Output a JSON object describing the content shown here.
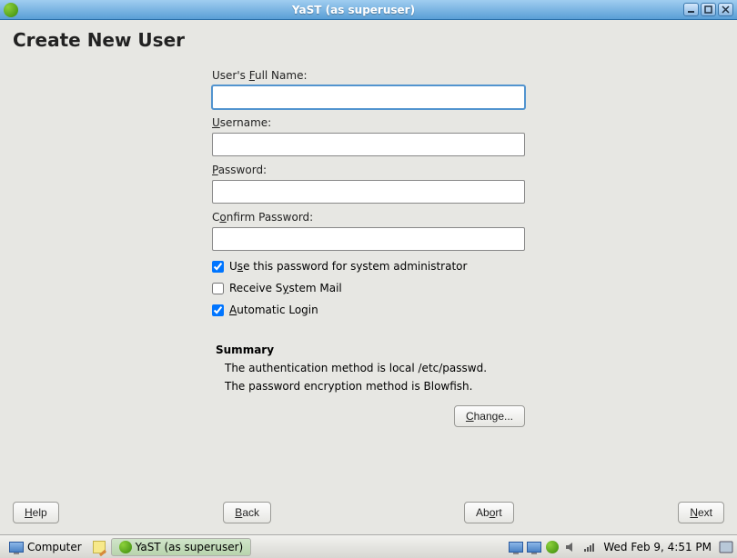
{
  "window": {
    "title": "YaST (as superuser)"
  },
  "page": {
    "heading": "Create New User",
    "fields": {
      "fullname": {
        "label_pre": "User's ",
        "accel": "F",
        "label_post": "ull Name:",
        "value": ""
      },
      "username": {
        "accel": "U",
        "label_post": "sername:",
        "value": ""
      },
      "password": {
        "accel": "P",
        "label_post": "assword:",
        "value": ""
      },
      "confirm": {
        "label_pre": "C",
        "accel": "o",
        "label_post": "nfirm Password:",
        "value": ""
      }
    },
    "checks": {
      "syspass": {
        "label_pre": "U",
        "accel": "s",
        "label_post": "e this password for system administrator",
        "checked": true
      },
      "sysmail": {
        "label_pre": "Receive S",
        "accel": "y",
        "label_post": "stem Mail",
        "checked": false
      },
      "autologin": {
        "accel": "A",
        "label_post": "utomatic Login",
        "checked": true
      }
    },
    "summary": {
      "heading": "Summary",
      "line1": "The authentication method is local /etc/passwd.",
      "line2": "The password encryption method is Blowfish."
    },
    "change": {
      "accel": "C",
      "label_post": "hange..."
    },
    "buttons": {
      "help": {
        "accel": "H",
        "label_post": "elp"
      },
      "back": {
        "accel": "B",
        "label_post": "ack"
      },
      "abort": {
        "label_pre": "Ab",
        "accel": "o",
        "label_post": "rt"
      },
      "next": {
        "accel": "N",
        "label_post": "ext"
      }
    }
  },
  "taskbar": {
    "computer": "Computer",
    "task": "YaST (as superuser)",
    "clock": "Wed Feb  9,  4:51 PM"
  }
}
